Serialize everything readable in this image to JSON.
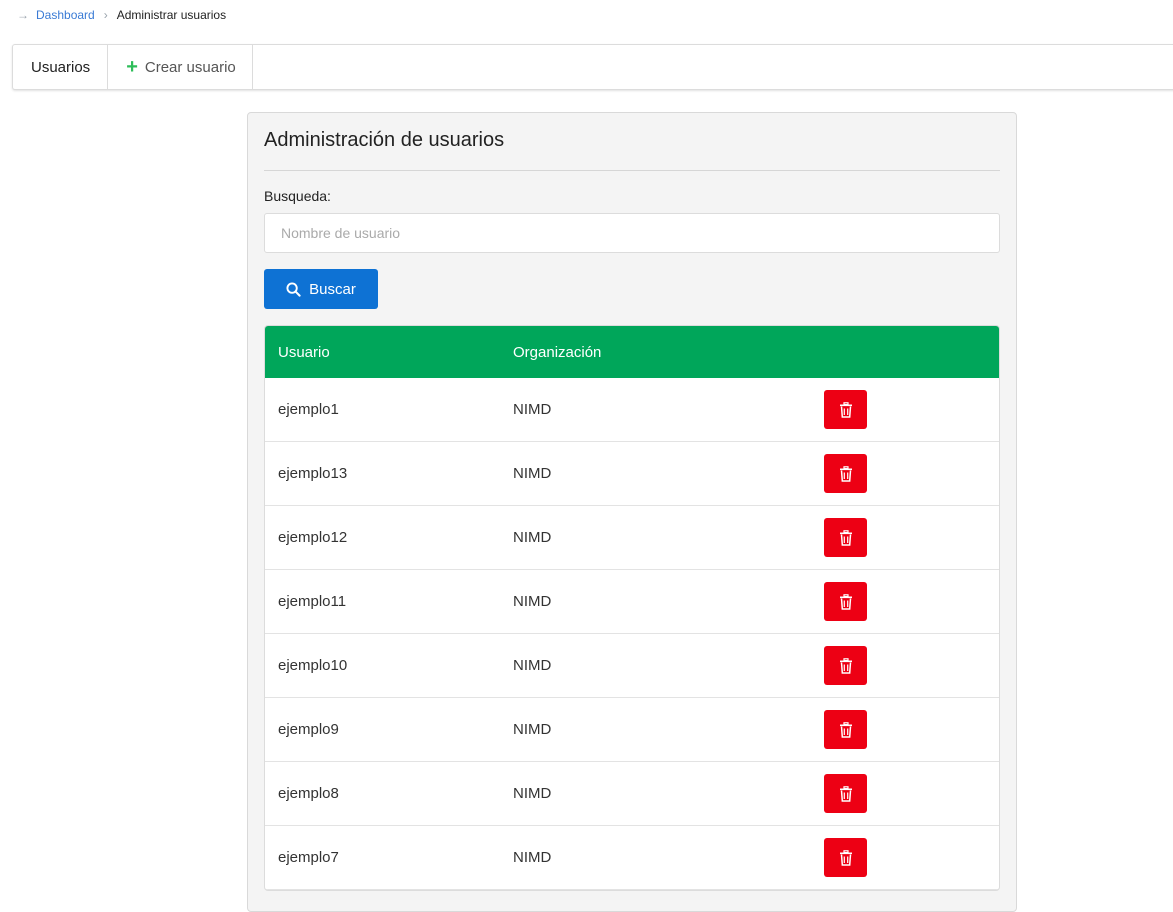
{
  "breadcrumb": {
    "items": [
      {
        "label": "Dashboard"
      },
      {
        "label": "Administrar usuarios"
      }
    ]
  },
  "tabs": {
    "users_label": "Usuarios",
    "create_label": "Crear usuario"
  },
  "panel": {
    "title": "Administración de usuarios",
    "search_label": "Busqueda:",
    "search_placeholder": "Nombre de usuario",
    "search_value": "",
    "search_button": "Buscar"
  },
  "table": {
    "headers": {
      "user": "Usuario",
      "org": "Organización"
    },
    "rows": [
      {
        "user": "ejemplo1",
        "org": "NIMD"
      },
      {
        "user": "ejemplo13",
        "org": "NIMD"
      },
      {
        "user": "ejemplo12",
        "org": "NIMD"
      },
      {
        "user": "ejemplo11",
        "org": "NIMD"
      },
      {
        "user": "ejemplo10",
        "org": "NIMD"
      },
      {
        "user": "ejemplo9",
        "org": "NIMD"
      },
      {
        "user": "ejemplo8",
        "org": "NIMD"
      },
      {
        "user": "ejemplo7",
        "org": "NIMD"
      }
    ]
  },
  "colors": {
    "header_green": "#00a65a",
    "primary_blue": "#0e72d4",
    "danger_red": "#ed0014",
    "plus_green": "#2ebd59"
  }
}
